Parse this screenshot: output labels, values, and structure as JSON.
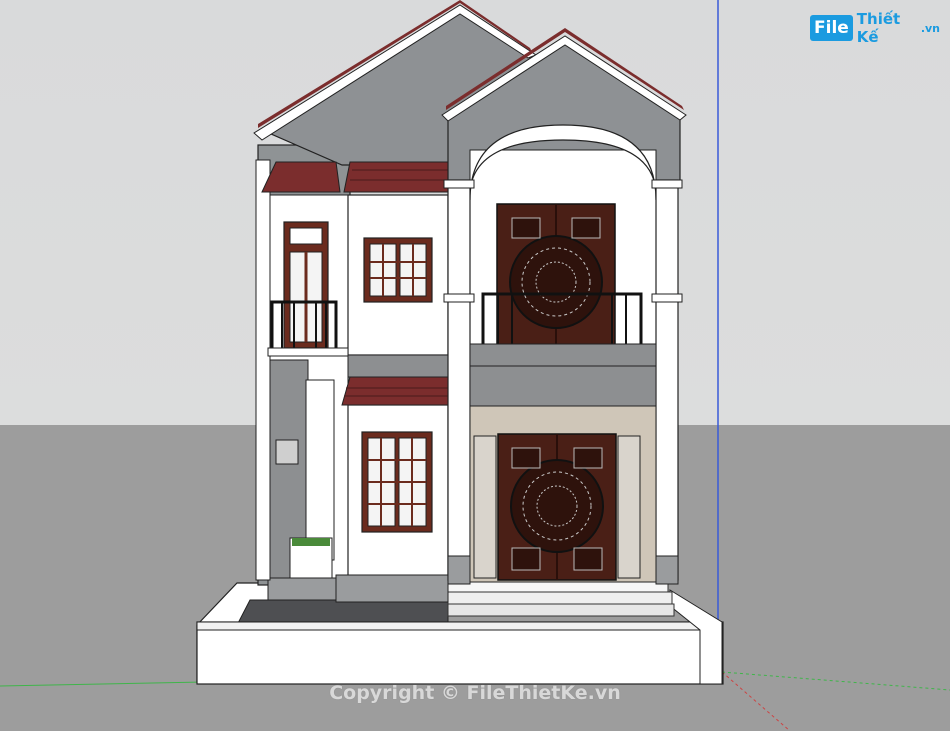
{
  "logo": {
    "badge": "File",
    "name": "Thiết Kế",
    "suffix": ".vn"
  },
  "watermark": "Copyright © FileThietKe.vn",
  "colors": {
    "sky": "#dcdddd",
    "ground": "#9d9d9d",
    "wall_white": "#ffffff",
    "wall_grey": "#8f9395",
    "stone": "#9a9c9e",
    "roof_tile": "#7b2d2d",
    "door_wood": "#4a1f16",
    "accent_blue": "#1b9be0"
  },
  "icons": [
    "axis-green-line",
    "axis-blue-line",
    "axis-red-dashed-line"
  ]
}
